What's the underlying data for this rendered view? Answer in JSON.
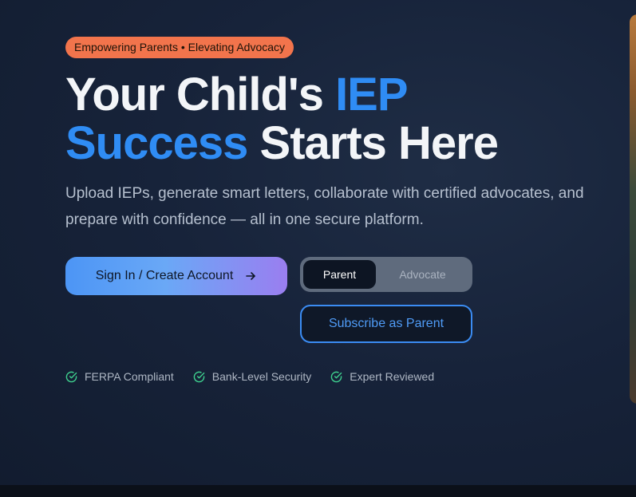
{
  "badge": {
    "text": "Empowering Parents • Elevating Advocacy"
  },
  "headline": {
    "part1": "Your Child's ",
    "accent1": "IEP",
    "accent2": "Success",
    "part2": " Starts Here"
  },
  "subtext": "Upload IEPs, generate smart letters, collaborate with certified advocates, and prepare with confidence — all in one secure platform.",
  "cta": {
    "label": "Sign In / Create Account",
    "icon": "arrow-right-icon"
  },
  "role_toggle": {
    "options": [
      "Parent",
      "Advocate"
    ],
    "selected": "Parent"
  },
  "subscribe": {
    "label": "Subscribe as Parent"
  },
  "trust_badges": [
    {
      "label": "FERPA Compliant",
      "icon": "check-circle-icon"
    },
    {
      "label": "Bank-Level Security",
      "icon": "check-circle-icon"
    },
    {
      "label": "Expert Reviewed",
      "icon": "check-circle-icon"
    }
  ],
  "colors": {
    "accent_blue": "#2f8cf4",
    "badge_orange": "#f2744c",
    "check_green": "#3ecf8e",
    "background": "#17233a"
  }
}
